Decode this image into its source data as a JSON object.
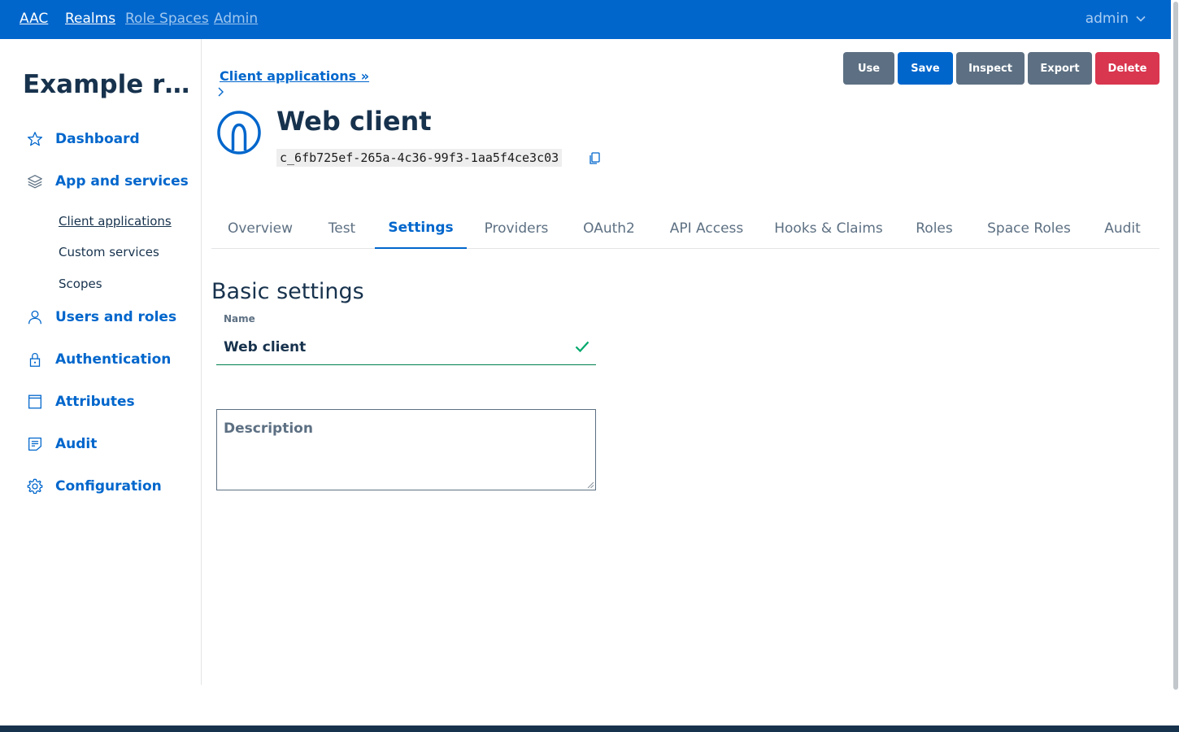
{
  "topbar": {
    "brand": "AAC",
    "links": [
      "Realms",
      "Role Spaces",
      "Admin"
    ],
    "user": "admin"
  },
  "sidebar": {
    "realm_title": "Example realm",
    "items": [
      {
        "label": "Dashboard",
        "icon": "star-icon"
      },
      {
        "label": "App and services",
        "icon": "layers-icon"
      },
      {
        "label": "Users and roles",
        "icon": "user-icon"
      },
      {
        "label": "Authentication",
        "icon": "lock-icon"
      },
      {
        "label": "Attributes",
        "icon": "archive-icon"
      },
      {
        "label": "Audit",
        "icon": "note-icon"
      },
      {
        "label": "Configuration",
        "icon": "gear-icon"
      }
    ],
    "subitems": [
      "Client applications",
      "Custom services",
      "Scopes"
    ],
    "active_subitem": "Client applications"
  },
  "breadcrumb": "Client applications »",
  "actions": [
    "Use",
    "Save",
    "Inspect",
    "Export",
    "Delete"
  ],
  "app": {
    "title": "Web client",
    "client_id": "c_6fb725ef-265a-4c36-99f3-1aa5f4ce3c03",
    "logo_icon": "openid-icon"
  },
  "tabs": [
    "Overview",
    "Test",
    "Settings",
    "Providers",
    "OAuth2",
    "API Access",
    "Hooks & Claims",
    "Roles",
    "Space Roles",
    "Audit"
  ],
  "active_tab": "Settings",
  "form": {
    "section_title": "Basic settings",
    "name_label": "Name",
    "name_value": "Web client",
    "description_placeholder": "Description"
  },
  "colors": {
    "primary": "#0066cc",
    "dark": "#17324d",
    "neutral": "#5d7083",
    "danger": "#d9364f",
    "success": "#00804d"
  }
}
